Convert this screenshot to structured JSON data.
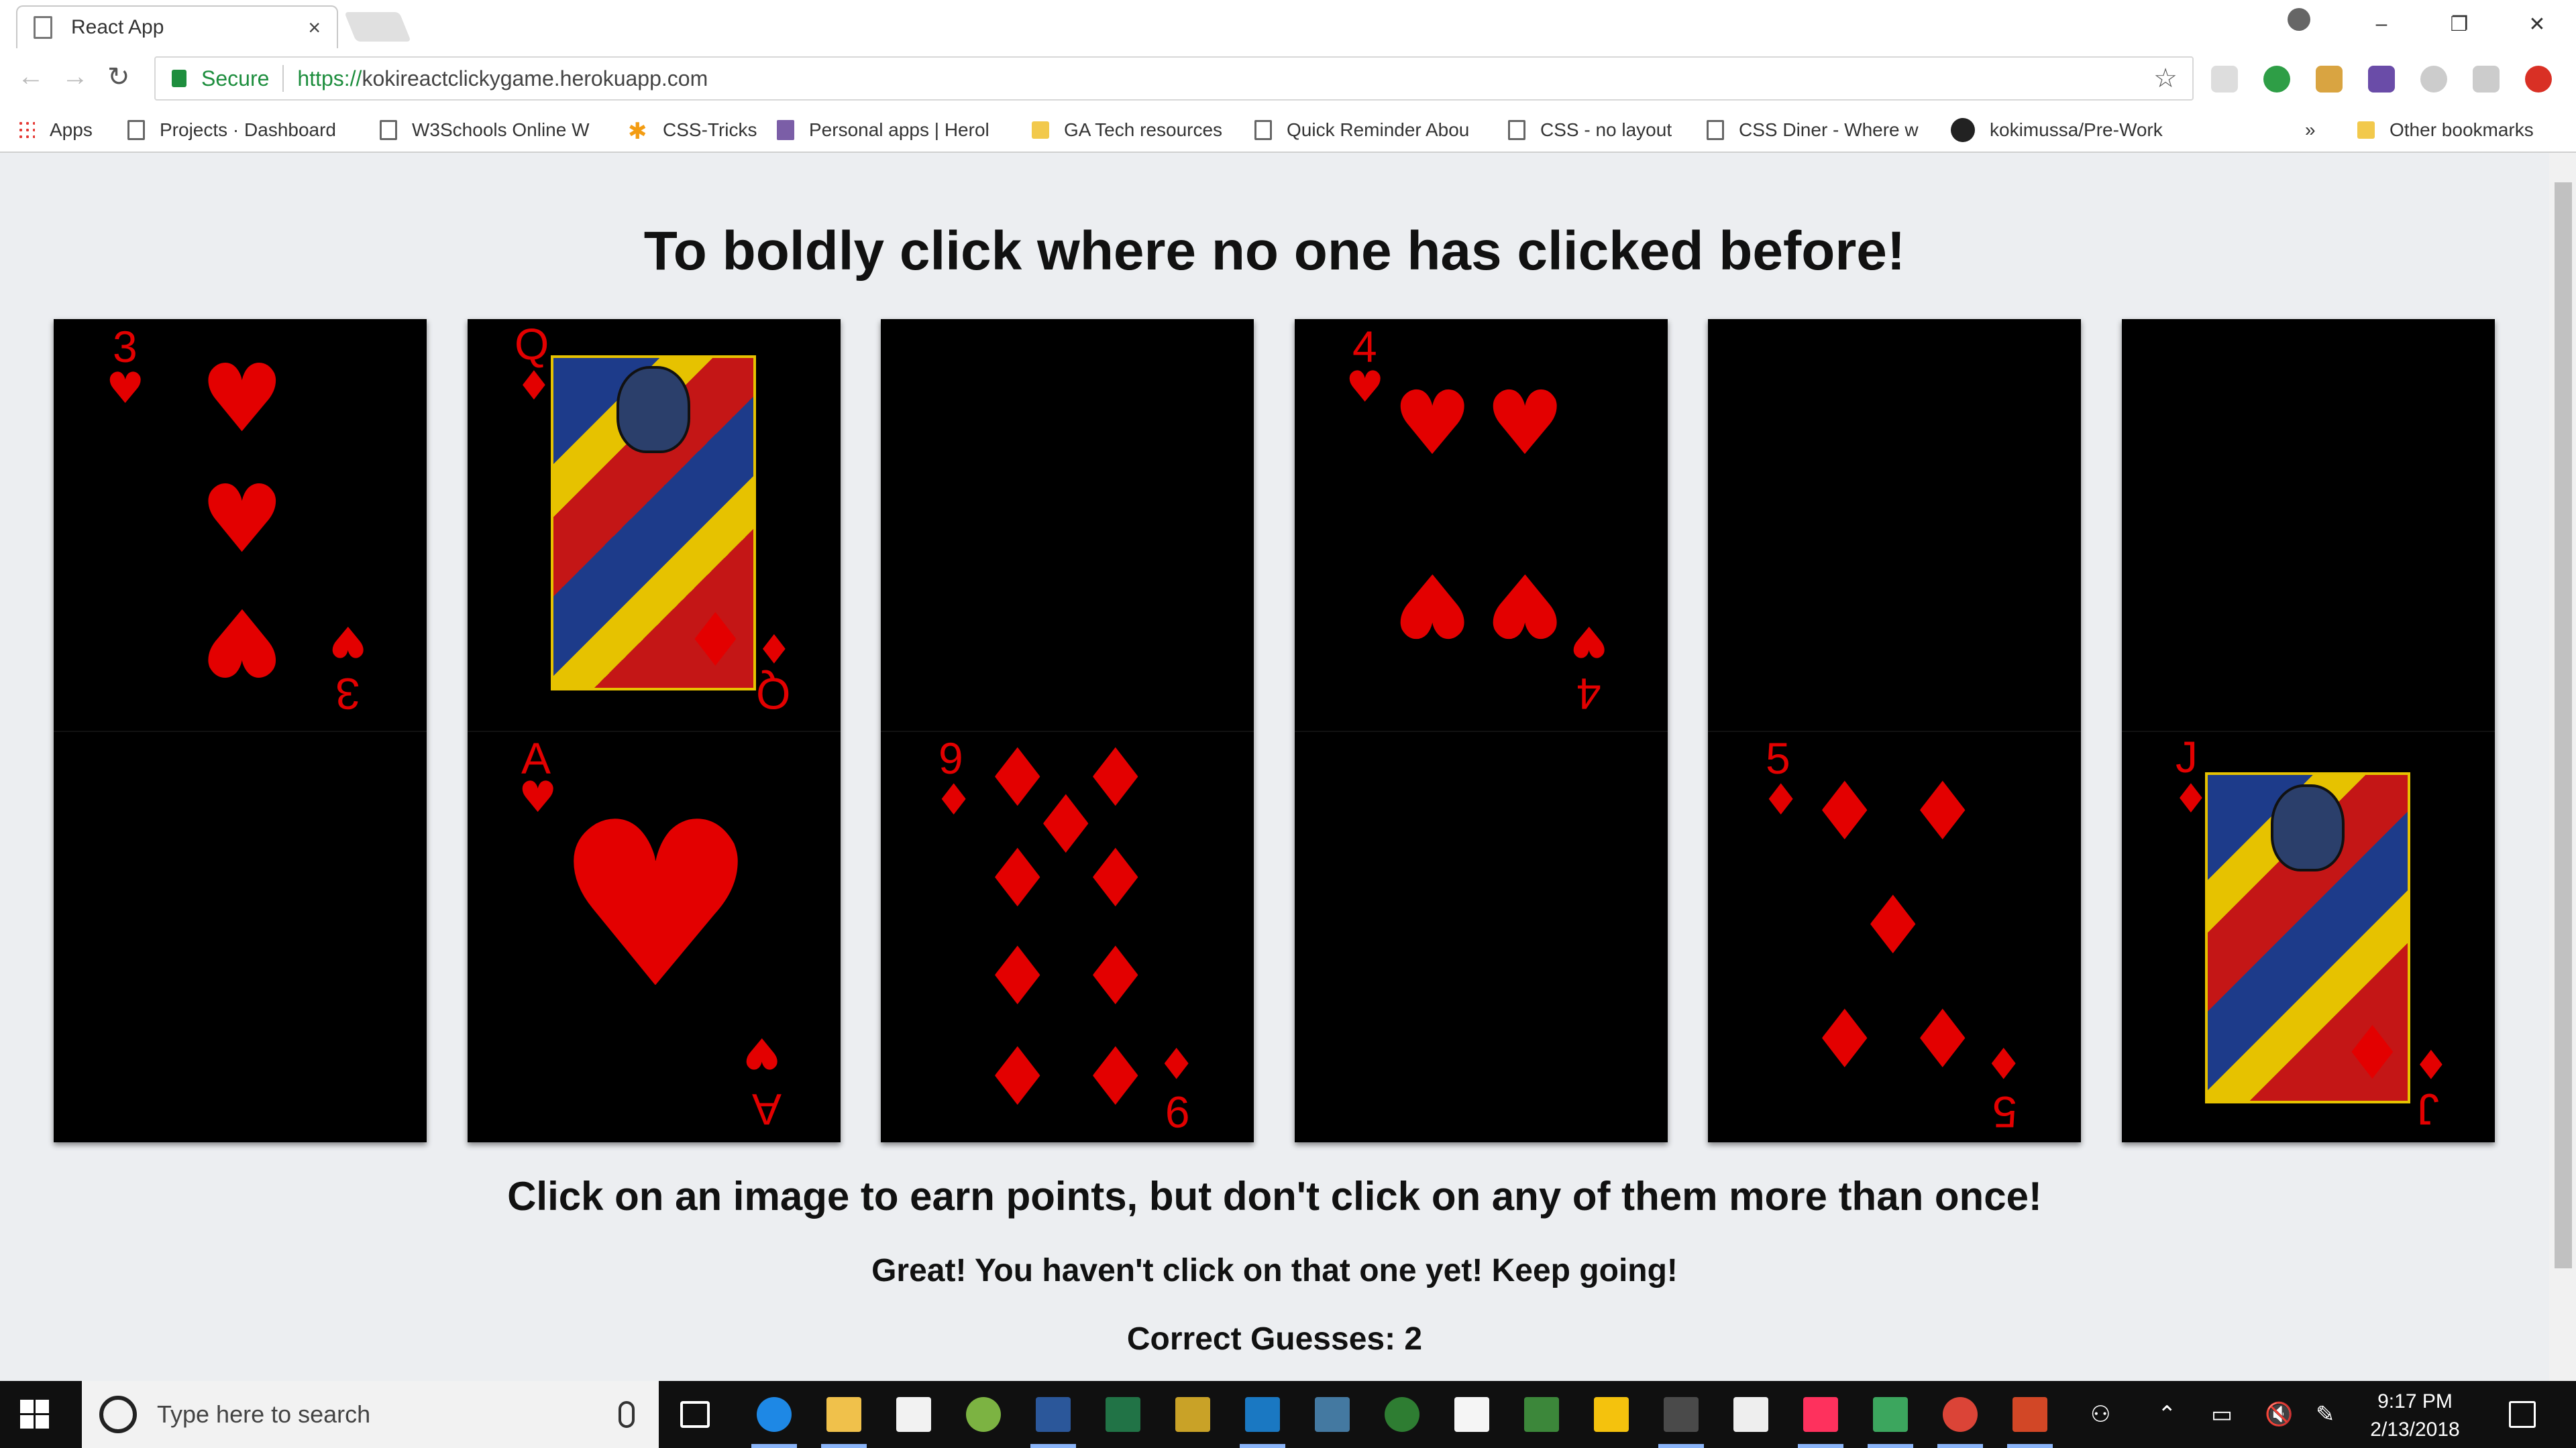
{
  "browser": {
    "tab_title": "React App",
    "tab_close": "×",
    "window_controls": [
      "–",
      "❐",
      "✕"
    ],
    "secure_label": "Secure",
    "url_protocol": "https://",
    "url_host": "kokireactclickygame.herokuapp.com",
    "bookmarks": [
      {
        "label": "Apps",
        "icon": "apps-grid-icon"
      },
      {
        "label": "Projects · Dashboard",
        "icon": "page-icon"
      },
      {
        "label": "W3Schools Online W",
        "icon": "page-icon"
      },
      {
        "label": "CSS-Tricks",
        "icon": "star-asterisk-icon"
      },
      {
        "label": "Personal apps | Herol",
        "icon": "heroku-icon"
      },
      {
        "label": "GA Tech resources",
        "icon": "folder-icon"
      },
      {
        "label": "Quick Reminder Abou",
        "icon": "page-icon"
      },
      {
        "label": "CSS - no layout",
        "icon": "page-icon"
      },
      {
        "label": "CSS Diner - Where w",
        "icon": "page-icon"
      },
      {
        "label": "kokimussa/Pre-Work",
        "icon": "github-icon"
      }
    ],
    "bookmarks_overflow": "»",
    "other_bookmarks": "Other bookmarks"
  },
  "page": {
    "heading": "To boldly click where no one has clicked before!",
    "instructions": "Click on an image to earn points, but don't click on any of them more than once!",
    "feedback": "Great! You haven't click on that one yet! Keep going!",
    "score_label": "Correct Guesses:",
    "score_value": "2",
    "cards": [
      {
        "top": {
          "rank": "3",
          "suit": "♥"
        },
        "bottom": null
      },
      {
        "top": {
          "rank": "Q",
          "suit": "♦"
        },
        "bottom": {
          "rank": "A",
          "suit": "♥"
        }
      },
      {
        "top": null,
        "bottom": {
          "rank": "9",
          "suit": "♦"
        }
      },
      {
        "top": {
          "rank": "4",
          "suit": "♥"
        },
        "bottom": null
      },
      {
        "top": null,
        "bottom": {
          "rank": "5",
          "suit": "♦"
        }
      },
      {
        "top": null,
        "bottom": {
          "rank": "J",
          "suit": "♦"
        }
      }
    ]
  },
  "taskbar": {
    "search_placeholder": "Type here to search",
    "time": "9:17 PM",
    "date": "2/13/2018",
    "apps": [
      "task-view-icon",
      "edge-icon",
      "file-explorer-icon",
      "store-icon",
      "app-green-icon",
      "word-icon",
      "excel-icon",
      "tool-icon",
      "webstorm-icon",
      "mysql-workbench-icon",
      "app-green-drop-icon",
      "sublime-s-icon",
      "node-icon",
      "app-yellow-icon",
      "sublime-text-icon",
      "java-icon",
      "intellij-icon",
      "git-kraken-icon",
      "chrome-icon",
      "powerpoint-icon"
    ]
  },
  "colors": {
    "card_red": "#e30000",
    "page_bg": "#eceef1",
    "secure_green": "#1e8e3e"
  }
}
